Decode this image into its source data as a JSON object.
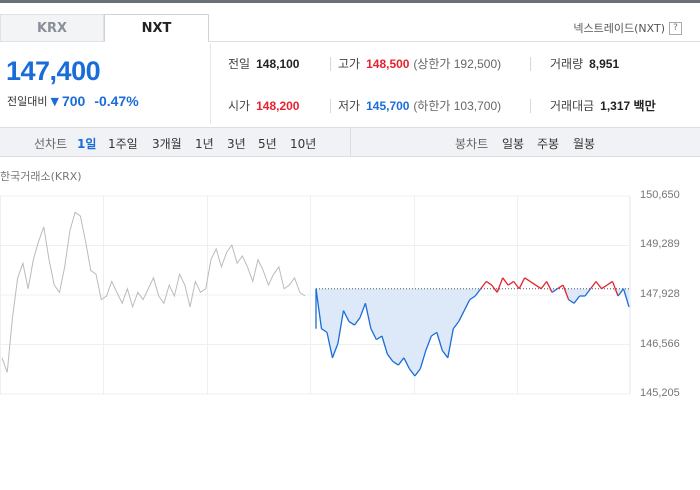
{
  "tabs": [
    {
      "label": "KRX"
    },
    {
      "label": "NXT"
    }
  ],
  "nextrade": {
    "label": "넥스트레이드(NXT)",
    "help_icon": "?"
  },
  "quote": {
    "price": "147,400",
    "change_label": "전일대비",
    "change_icon": "down-triangle",
    "change_amount": "700",
    "change_percent": "-0.47%"
  },
  "stats": {
    "prev_close": {
      "label": "전일",
      "value": "148,100"
    },
    "open": {
      "label": "시가",
      "value": "148,200"
    },
    "high": {
      "label": "고가",
      "value": "148,500",
      "sub": "(상한가 192,500)"
    },
    "low": {
      "label": "저가",
      "value": "145,700",
      "sub": "(하한가 103,700)"
    },
    "volume": {
      "label": "거래량",
      "value": "8,951"
    },
    "amount": {
      "label": "거래대금",
      "value": "1,317 백만"
    }
  },
  "toolbar": {
    "line_chart_label": "선차트",
    "periods": [
      "1일",
      "1주일",
      "3개월",
      "1년",
      "3년",
      "5년",
      "10년"
    ],
    "active_period": "1일",
    "candle_chart_label": "봉차트",
    "candle_periods": [
      "일봉",
      "주봉",
      "월봉"
    ]
  },
  "chart_meta": {
    "exchange_label": "한국거래소(KRX)"
  },
  "colors": {
    "up": "#e5232e",
    "down": "#1a6cd8",
    "accent": "#1a6cd8",
    "prev_line": "#bbbbbb"
  },
  "chart_data": {
    "type": "line",
    "ylim": [
      145205,
      150650
    ],
    "yticks": [
      "150,650",
      "149,289",
      "147,928",
      "146,566",
      "145,205"
    ],
    "reference_value": 148100,
    "series": [
      {
        "values": [
          146200,
          145800,
          147300,
          148400,
          148800,
          148100,
          148900,
          149400,
          149800,
          148900,
          148200,
          148000,
          148700,
          149700,
          150200,
          150100,
          149400,
          148600,
          148500,
          147800,
          147900,
          148300,
          148000,
          147700,
          148100,
          147600,
          148000,
          147800,
          148100,
          148400,
          147900,
          147700,
          148200,
          147900,
          148500,
          148200,
          147600,
          148300,
          148000,
          148100,
          148900,
          149200,
          148700,
          149100,
          149300,
          148800,
          149000,
          148700,
          148300,
          148900,
          148600,
          148200,
          148500,
          148700,
          148100,
          148200,
          148400,
          148000,
          147900
        ]
      },
      {
        "values": [
          148100,
          147000,
          146900,
          146200,
          146600,
          147500,
          147200,
          147100,
          147300,
          147700,
          147000,
          146700,
          146800,
          146300,
          146100,
          146000,
          146200,
          145900,
          145700,
          145900,
          146400,
          146800,
          146900,
          146400,
          146200,
          147000,
          147200,
          147500,
          147800,
          147900,
          148100,
          148300,
          148200,
          148000,
          148400,
          148200,
          148300,
          148100,
          148400,
          148300,
          148200,
          148100,
          148300,
          148000,
          148100,
          148200,
          147800,
          147700,
          147900,
          147900,
          148100,
          148300,
          148100,
          148200,
          148300,
          147900,
          148100,
          147600
        ]
      }
    ]
  }
}
